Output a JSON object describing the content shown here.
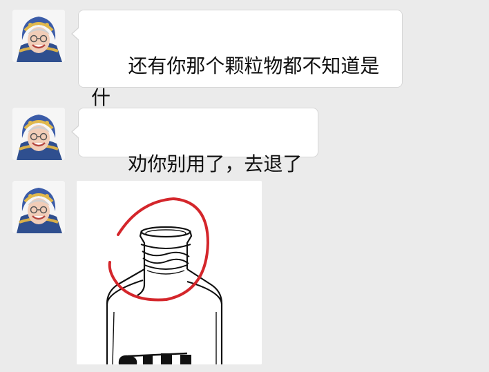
{
  "conversation": {
    "messages": [
      {
        "sender_avatar_icon": "woman-headscarf-avatar-icon",
        "type": "text",
        "text": "还有你那个颗粒物都不知道是什\n么东东"
      },
      {
        "sender_avatar_icon": "woman-headscarf-avatar-icon",
        "type": "text",
        "text": "劝你别用了，去退了吧"
      },
      {
        "sender_avatar_icon": "woman-headscarf-avatar-icon",
        "type": "image",
        "image_icon": "circled-bottle-neck-sketch-icon"
      }
    ]
  },
  "colors": {
    "background": "#ebebeb",
    "bubble": "#ffffff",
    "bubble_border": "#d6d6d6",
    "circle_annotation": "#d4262b"
  }
}
